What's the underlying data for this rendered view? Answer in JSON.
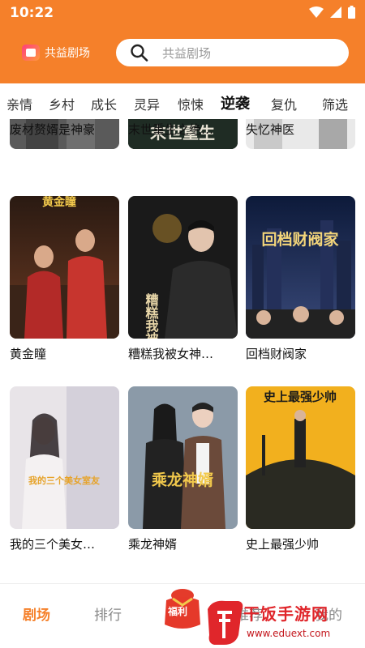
{
  "status": {
    "time": "10:22"
  },
  "app": {
    "name": "共益剧场"
  },
  "search": {
    "placeholder": "共益剧场"
  },
  "categories": [
    "亲情",
    "乡村",
    "成长",
    "灵异",
    "惊悚",
    "逆袭",
    "复仇",
    "筛选"
  ],
  "active_category": "逆袭",
  "dramas": [
    {
      "title": "废材赘婿是神豪"
    },
    {
      "title": "末世重生之绝…",
      "poster_text": "末世重生"
    },
    {
      "title": "失忆神医"
    },
    {
      "title": "黄金瞳",
      "poster_text": "黄金瞳"
    },
    {
      "title": "糟糕我被女神…",
      "poster_text": "糟糕我被女神包养了"
    },
    {
      "title": "回档财阀家",
      "poster_text": "回档财阀家"
    },
    {
      "title": "我的三个美女…",
      "poster_text": "我的三个美女室友"
    },
    {
      "title": "乘龙神婿",
      "poster_text": "乘龙神婿"
    },
    {
      "title": "史上最强少帅",
      "poster_text": "史上最强少帅"
    }
  ],
  "bottom_nav": {
    "theater": "剧场",
    "ranking": "排行",
    "welfare": "福利",
    "recommend": "推荐",
    "mine": "我的"
  },
  "watermark": {
    "brand": "干饭手游网",
    "url": "www.eduext.com"
  },
  "colors": {
    "accent": "#f5802a",
    "watermark": "#e0262b"
  }
}
